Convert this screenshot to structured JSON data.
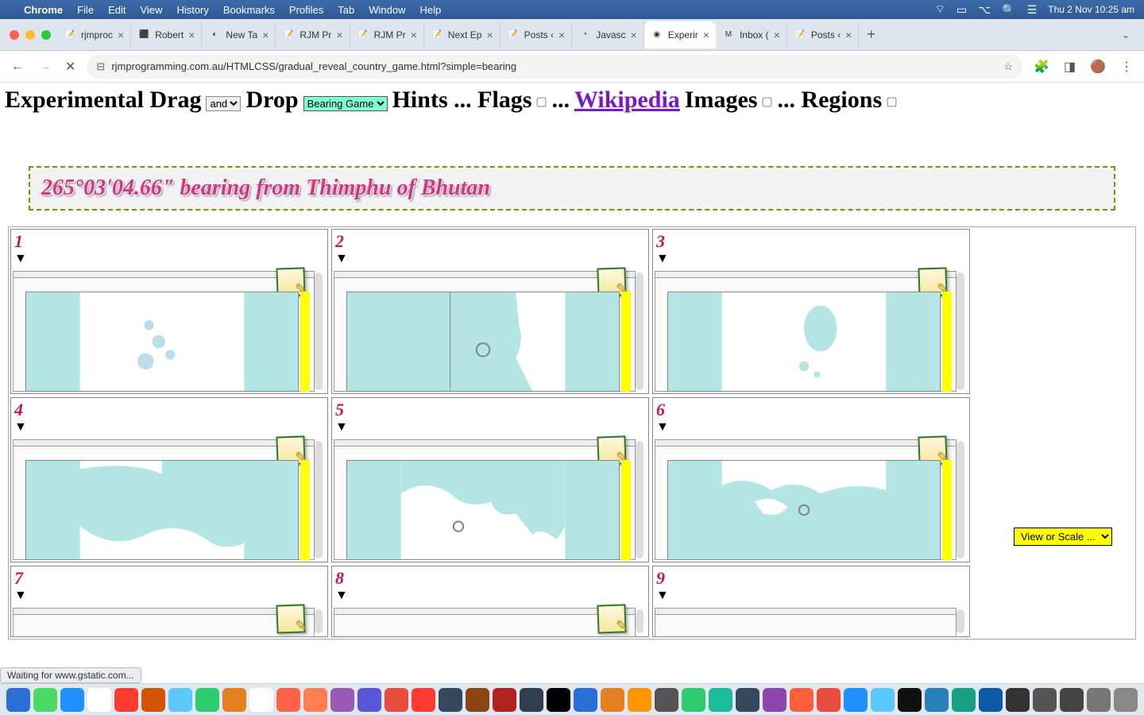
{
  "menubar": {
    "app": "Chrome",
    "items": [
      "File",
      "Edit",
      "View",
      "History",
      "Bookmarks",
      "Profiles",
      "Tab",
      "Window",
      "Help"
    ],
    "clock": "Thu 2 Nov  10:25 am"
  },
  "tabs": [
    {
      "title": "rjmproc",
      "fav": "📝"
    },
    {
      "title": "Robert",
      "fav": "⬛"
    },
    {
      "title": "New Ta",
      "fav": "◐"
    },
    {
      "title": "RJM Pr",
      "fav": "📝"
    },
    {
      "title": "RJM Pr",
      "fav": "📝"
    },
    {
      "title": "Next Ep",
      "fav": "📝"
    },
    {
      "title": "Posts ‹",
      "fav": "📝"
    },
    {
      "title": "Javasc",
      "fav": "◔"
    },
    {
      "title": "Experir",
      "fav": "◉",
      "active": true
    },
    {
      "title": "Inbox (",
      "fav": "M"
    },
    {
      "title": "Posts ‹",
      "fav": "📝"
    }
  ],
  "url": "rjmprogramming.com.au/HTMLCSS/gradual_reveal_country_game.html?simple=bearing",
  "page": {
    "h_experimental": "Experimental Drag",
    "sel_and": "and",
    "h_drop": "Drop",
    "sel_bearing": "Bearing Game",
    "h_hints": "Hints ... Flags",
    "h_dots": "...",
    "link_wiki": "Wikipedia",
    "h_images": "Images",
    "h_regions": "... Regions",
    "clue": "265°03'04.66\" bearing from Thimphu of Bhutan",
    "cells": [
      "1",
      "2",
      "3",
      "4",
      "5",
      "6",
      "7",
      "8",
      "9"
    ],
    "viewscale": "View or Scale ...",
    "status": "Waiting for www.gstatic.com..."
  },
  "dock_colors": [
    "#2a6fd6",
    "#4cd964",
    "#1e90ff",
    "#fff",
    "#ff3b30",
    "#d35400",
    "#5ac8fa",
    "#2ecc71",
    "#e67e22",
    "#fff",
    "#ff6347",
    "#ff7f50",
    "#9b59b6",
    "#5856d6",
    "#e74c3c",
    "#ff3b30",
    "#34495e",
    "#8B4513",
    "#b22222",
    "#2c3e50",
    "#000",
    "#2a6fd6",
    "#e67e22",
    "#ff9500",
    "#555",
    "#2ecc71",
    "#1abc9c",
    "#34495e",
    "#8e44ad",
    "#ff5e3a",
    "#e74c3c",
    "#1e90ff",
    "#5ac8fa",
    "#111",
    "#2980b9",
    "#16a085",
    "#0e5aa7",
    "#333",
    "#555",
    "#444",
    "#777",
    "#888"
  ]
}
